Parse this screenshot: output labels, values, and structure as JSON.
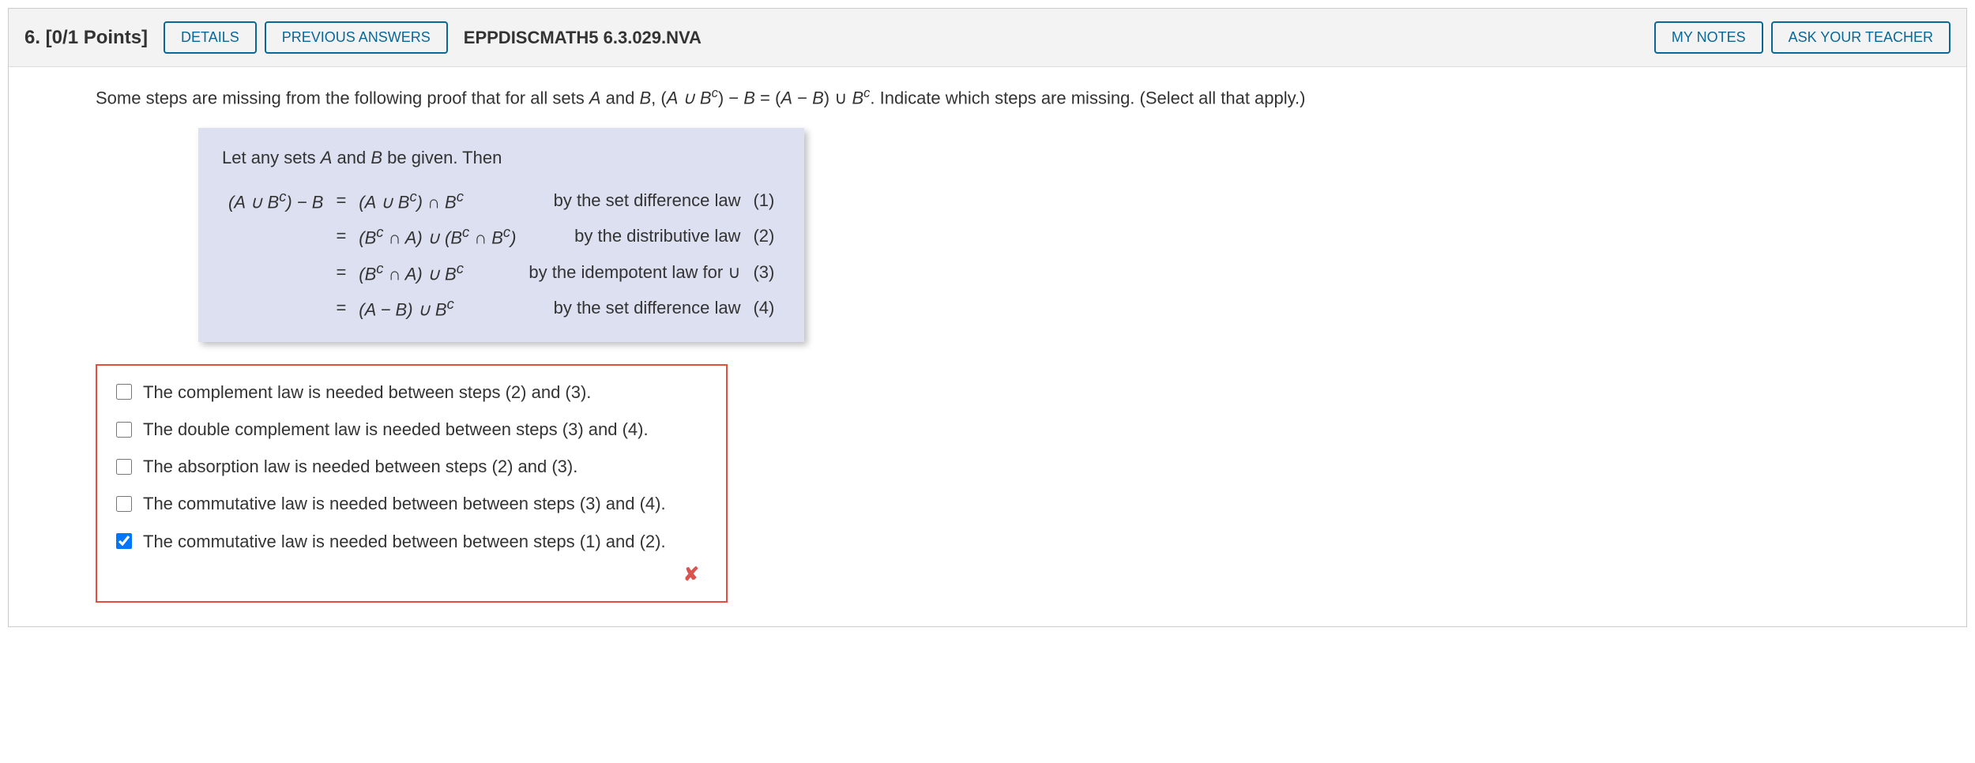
{
  "header": {
    "number_points": "6. [0/1 Points]",
    "details_btn": "DETAILS",
    "prev_answers_btn": "PREVIOUS ANSWERS",
    "code": "EPPDISCMATH5 6.3.029.NVA",
    "my_notes_btn": "MY NOTES",
    "ask_teacher_btn": "ASK YOUR TEACHER"
  },
  "prompt": {
    "pre": "Some steps are missing from the following proof that for all sets ",
    "A": "A",
    "and": " and ",
    "B": "B",
    "mid": ", (",
    "expr_lhs": "A ∪ B",
    "c1": "c",
    "paren_minus": ") − ",
    "B2": "B",
    "eq": " = (",
    "A2": "A",
    "minus": " − ",
    "B3": "B",
    "union": ") ∪ ",
    "B4": "B",
    "c2": "c",
    "post": ". Indicate which steps are missing. (Select all that apply.)"
  },
  "proof": {
    "intro_pre": "Let any sets ",
    "intro_A": "A",
    "intro_and": " and ",
    "intro_B": "B",
    "intro_post": " be given. Then",
    "rows": [
      {
        "lhs": "(A ∪ B<sup>c</sup>) − B",
        "eq": "=",
        "rhs": "(A ∪ B<sup>c</sup>) ∩ B<sup>c</sup>",
        "reason": "by the set difference law",
        "num": "(1)"
      },
      {
        "lhs": "",
        "eq": "=",
        "rhs": "(B<sup>c</sup> ∩ A) ∪ (B<sup>c</sup> ∩ B<sup>c</sup>)",
        "reason": "by the distributive law",
        "num": "(2)"
      },
      {
        "lhs": "",
        "eq": "=",
        "rhs": "(B<sup>c</sup> ∩ A) ∪ B<sup>c</sup>",
        "reason": "by the idempotent law for ∪",
        "num": "(3)"
      },
      {
        "lhs": "",
        "eq": "=",
        "rhs": "(A − B) ∪ B<sup>c</sup>",
        "reason": "by the set difference law",
        "num": "(4)"
      }
    ]
  },
  "answers": [
    {
      "checked": false,
      "text": "The complement law is needed between steps (2) and (3)."
    },
    {
      "checked": false,
      "text": "The double complement law is needed between steps (3) and (4)."
    },
    {
      "checked": false,
      "text": "The absorption law is needed between steps (2) and (3)."
    },
    {
      "checked": false,
      "text": "The commutative law is needed between between steps (3) and (4)."
    },
    {
      "checked": true,
      "text": "The commutative law is needed between between steps (1) and (2)."
    }
  ],
  "feedback": {
    "x": "✘"
  }
}
